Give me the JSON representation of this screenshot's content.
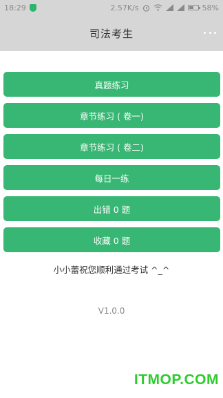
{
  "status_bar": {
    "time": "18:29",
    "speed": "2.57K/s",
    "battery": "58%",
    "battery_level": 0.58,
    "icons": [
      "shield-icon",
      "alarm-icon",
      "wifi-icon",
      "signal-icon",
      "signal-icon",
      "battery-icon"
    ]
  },
  "header": {
    "title": "司法考生",
    "more_icon": "more-dots-icon"
  },
  "menu": {
    "items": [
      {
        "label": "真题练习"
      },
      {
        "label": "章节练习 ( 卷一)"
      },
      {
        "label": "章节练习 ( 卷二)"
      },
      {
        "label": "每日一练"
      },
      {
        "label": "出错 0 题"
      },
      {
        "label": "收藏 0 题"
      }
    ],
    "button_color": "#38b673"
  },
  "greeting": "小小蕾祝您顺利通过考试  ^_^",
  "version": "V1.0.0",
  "watermark": "ITMOP.COM"
}
